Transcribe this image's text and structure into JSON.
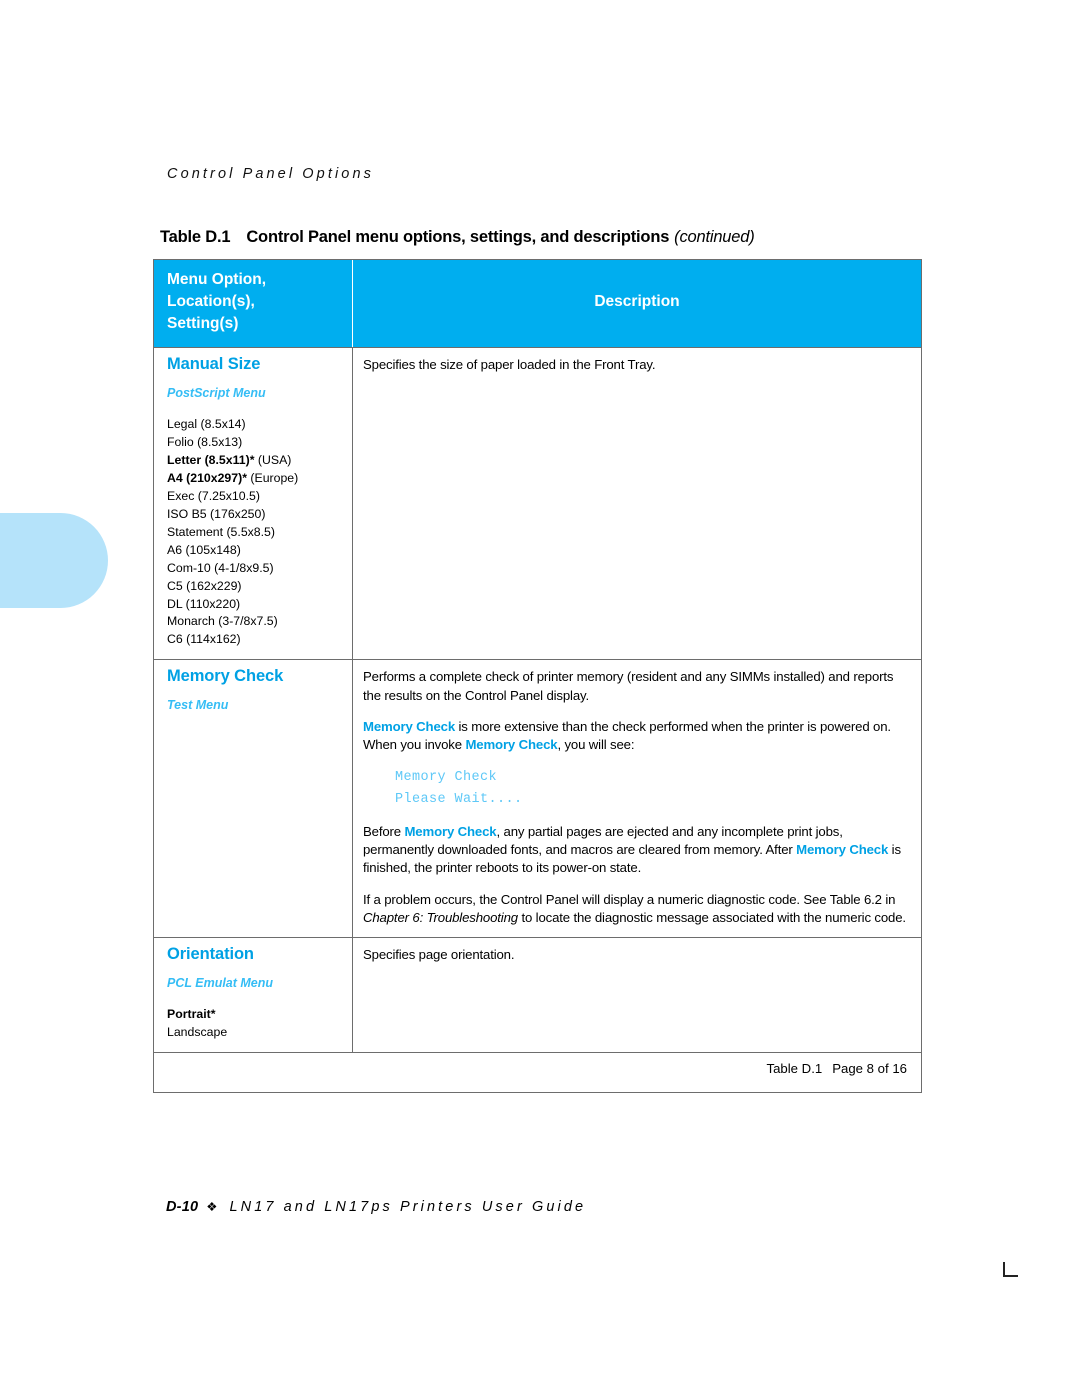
{
  "running_head": "Control Panel Options",
  "table_caption": {
    "number": "Table D.1",
    "text": "Control Panel menu options, settings, and descriptions",
    "continued": "(continued)"
  },
  "table_header": {
    "col1": "Menu Option, Location(s), Setting(s)",
    "col1_line1": "Menu Option,",
    "col1_line2": "Location(s),",
    "col1_line3": "Setting(s)",
    "col2": "Description"
  },
  "rows": [
    {
      "option": "Manual Size",
      "menu": "PostScript Menu",
      "settings": [
        "Legal (8.5x14)",
        "Folio (8.5x13)",
        "Letter (8.5x11)* (USA)",
        "A4 (210x297)* (Europe)",
        "Exec (7.25x10.5)",
        "ISO B5 (176x250)",
        "Statement (5.5x8.5)",
        "A6 (105x148)",
        "Com-10 (4-1/8x9.5)",
        "C5 (162x229)",
        "DL (110x220)",
        "Monarch (3-7/8x7.5)",
        "C6 (114x162)"
      ],
      "settings_bold": {
        "letter_bold": "Letter (8.5x11)*",
        "letter_rest": " (USA)",
        "a4_bold": "A4 (210x297)*",
        "a4_rest": " (Europe)"
      },
      "description_p1": "Specifies the size of paper loaded in the Front Tray."
    },
    {
      "option": "Memory Check",
      "menu": "Test Menu",
      "description_p1": "Performs a complete check of printer memory (resident and any SIMMs installed) and reports the results on the Control Panel display.",
      "description_p2_a": "Memory Check",
      "description_p2_b": " is more extensive than the check performed when the printer is powered on. When you invoke ",
      "description_p2_c": "Memory Check",
      "description_p2_d": ", you will see:",
      "lcd_line1": "Memory Check",
      "lcd_line2": "Please Wait....",
      "description_p3_a": "Before ",
      "description_p3_b": "Memory Check",
      "description_p3_c": ", any partial pages are ejected and any incomplete print jobs, permanently downloaded fonts, and macros are cleared from memory. After ",
      "description_p3_d": "Memory Check",
      "description_p3_e": " is finished, the printer reboots to its power-on state.",
      "description_p4_a": "If a problem occurs, the Control Panel will display a numeric diagnostic code. See Table 6.2 in ",
      "description_p4_b": "Chapter 6: Troubleshooting",
      "description_p4_c": " to locate the diagnostic message associated with the numeric code."
    },
    {
      "option": "Orientation",
      "menu": "PCL Emulat Menu",
      "settings": [
        "Portrait*",
        "Landscape"
      ],
      "setting_default": "Portrait*",
      "setting_other": "Landscape",
      "description_p1": "Specifies page orientation."
    }
  ],
  "table_footer": {
    "label": "Table D.1",
    "page": "Page 8 of 16"
  },
  "page_footer": {
    "folio": "D-10",
    "diamond": "❖",
    "title": "LN17 and LN17ps Printers User Guide"
  },
  "colors": {
    "header_band": "#00aeef",
    "heading_blue": "#00a1e4",
    "menu_blue": "#35bdf5",
    "lcd_blue": "#5ec8f7",
    "side_tab": "#b5e3fa",
    "rule": "#6d6d6d"
  }
}
